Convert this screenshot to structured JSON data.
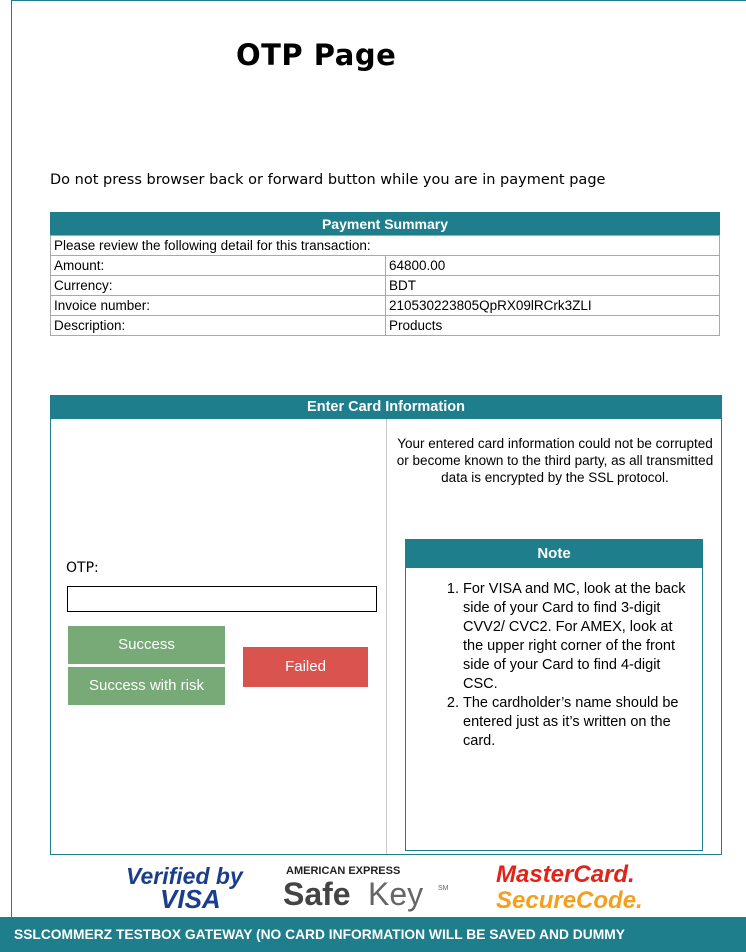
{
  "page": {
    "title": "OTP Page",
    "warning": "Do not press browser back or forward button while you are in payment page"
  },
  "summary": {
    "header": "Payment Summary",
    "intro": "Please review the following detail for this transaction:",
    "rows": [
      {
        "label": "Amount:",
        "value": "64800.00"
      },
      {
        "label": "Currency:",
        "value": "BDT"
      },
      {
        "label": "Invoice number:",
        "value": "210530223805QpRX09lRCrk3ZLI"
      },
      {
        "label": "Description:",
        "value": "Products"
      }
    ]
  },
  "card": {
    "header": "Enter Card Information",
    "otp_label": "OTP:",
    "otp_value": "",
    "success_label": "Success",
    "success_risk_label": "Success with risk",
    "failed_label": "Failed",
    "info_text": "Your entered card information could not be corrupted or become known to the third party, as all transmitted data is encrypted by the SSL protocol.",
    "note_header": "Note",
    "note_items": [
      "For VISA and MC, look at the back side of your Card to find 3-digit CVV2/ CVC2. For AMEX, look at the upper right corner of the front side of your Card to find 4-digit CSC.",
      "The cardholder’s name should be entered just as it’s written on the card."
    ]
  },
  "logos": {
    "visa_top": "Verified by",
    "visa_bottom": "VISA",
    "amex_top": "AMERICAN EXPRESS",
    "amex_safe": "Safe",
    "amex_key": "Key",
    "amex_sm": "SM",
    "mc_top": "MasterCard.",
    "mc_bottom": "SecureCode."
  },
  "footer": {
    "text": "SSLCOMMERZ TESTBOX GATEWAY (NO CARD INFORMATION WILL BE SAVED AND DUMMY"
  },
  "colors": {
    "primary": "#1f7e8c",
    "success": "#77aa77",
    "failed": "#d9534f",
    "visa_blue": "#1a3e8c",
    "mc_red": "#e2231a",
    "mc_orange": "#f79e1b"
  }
}
